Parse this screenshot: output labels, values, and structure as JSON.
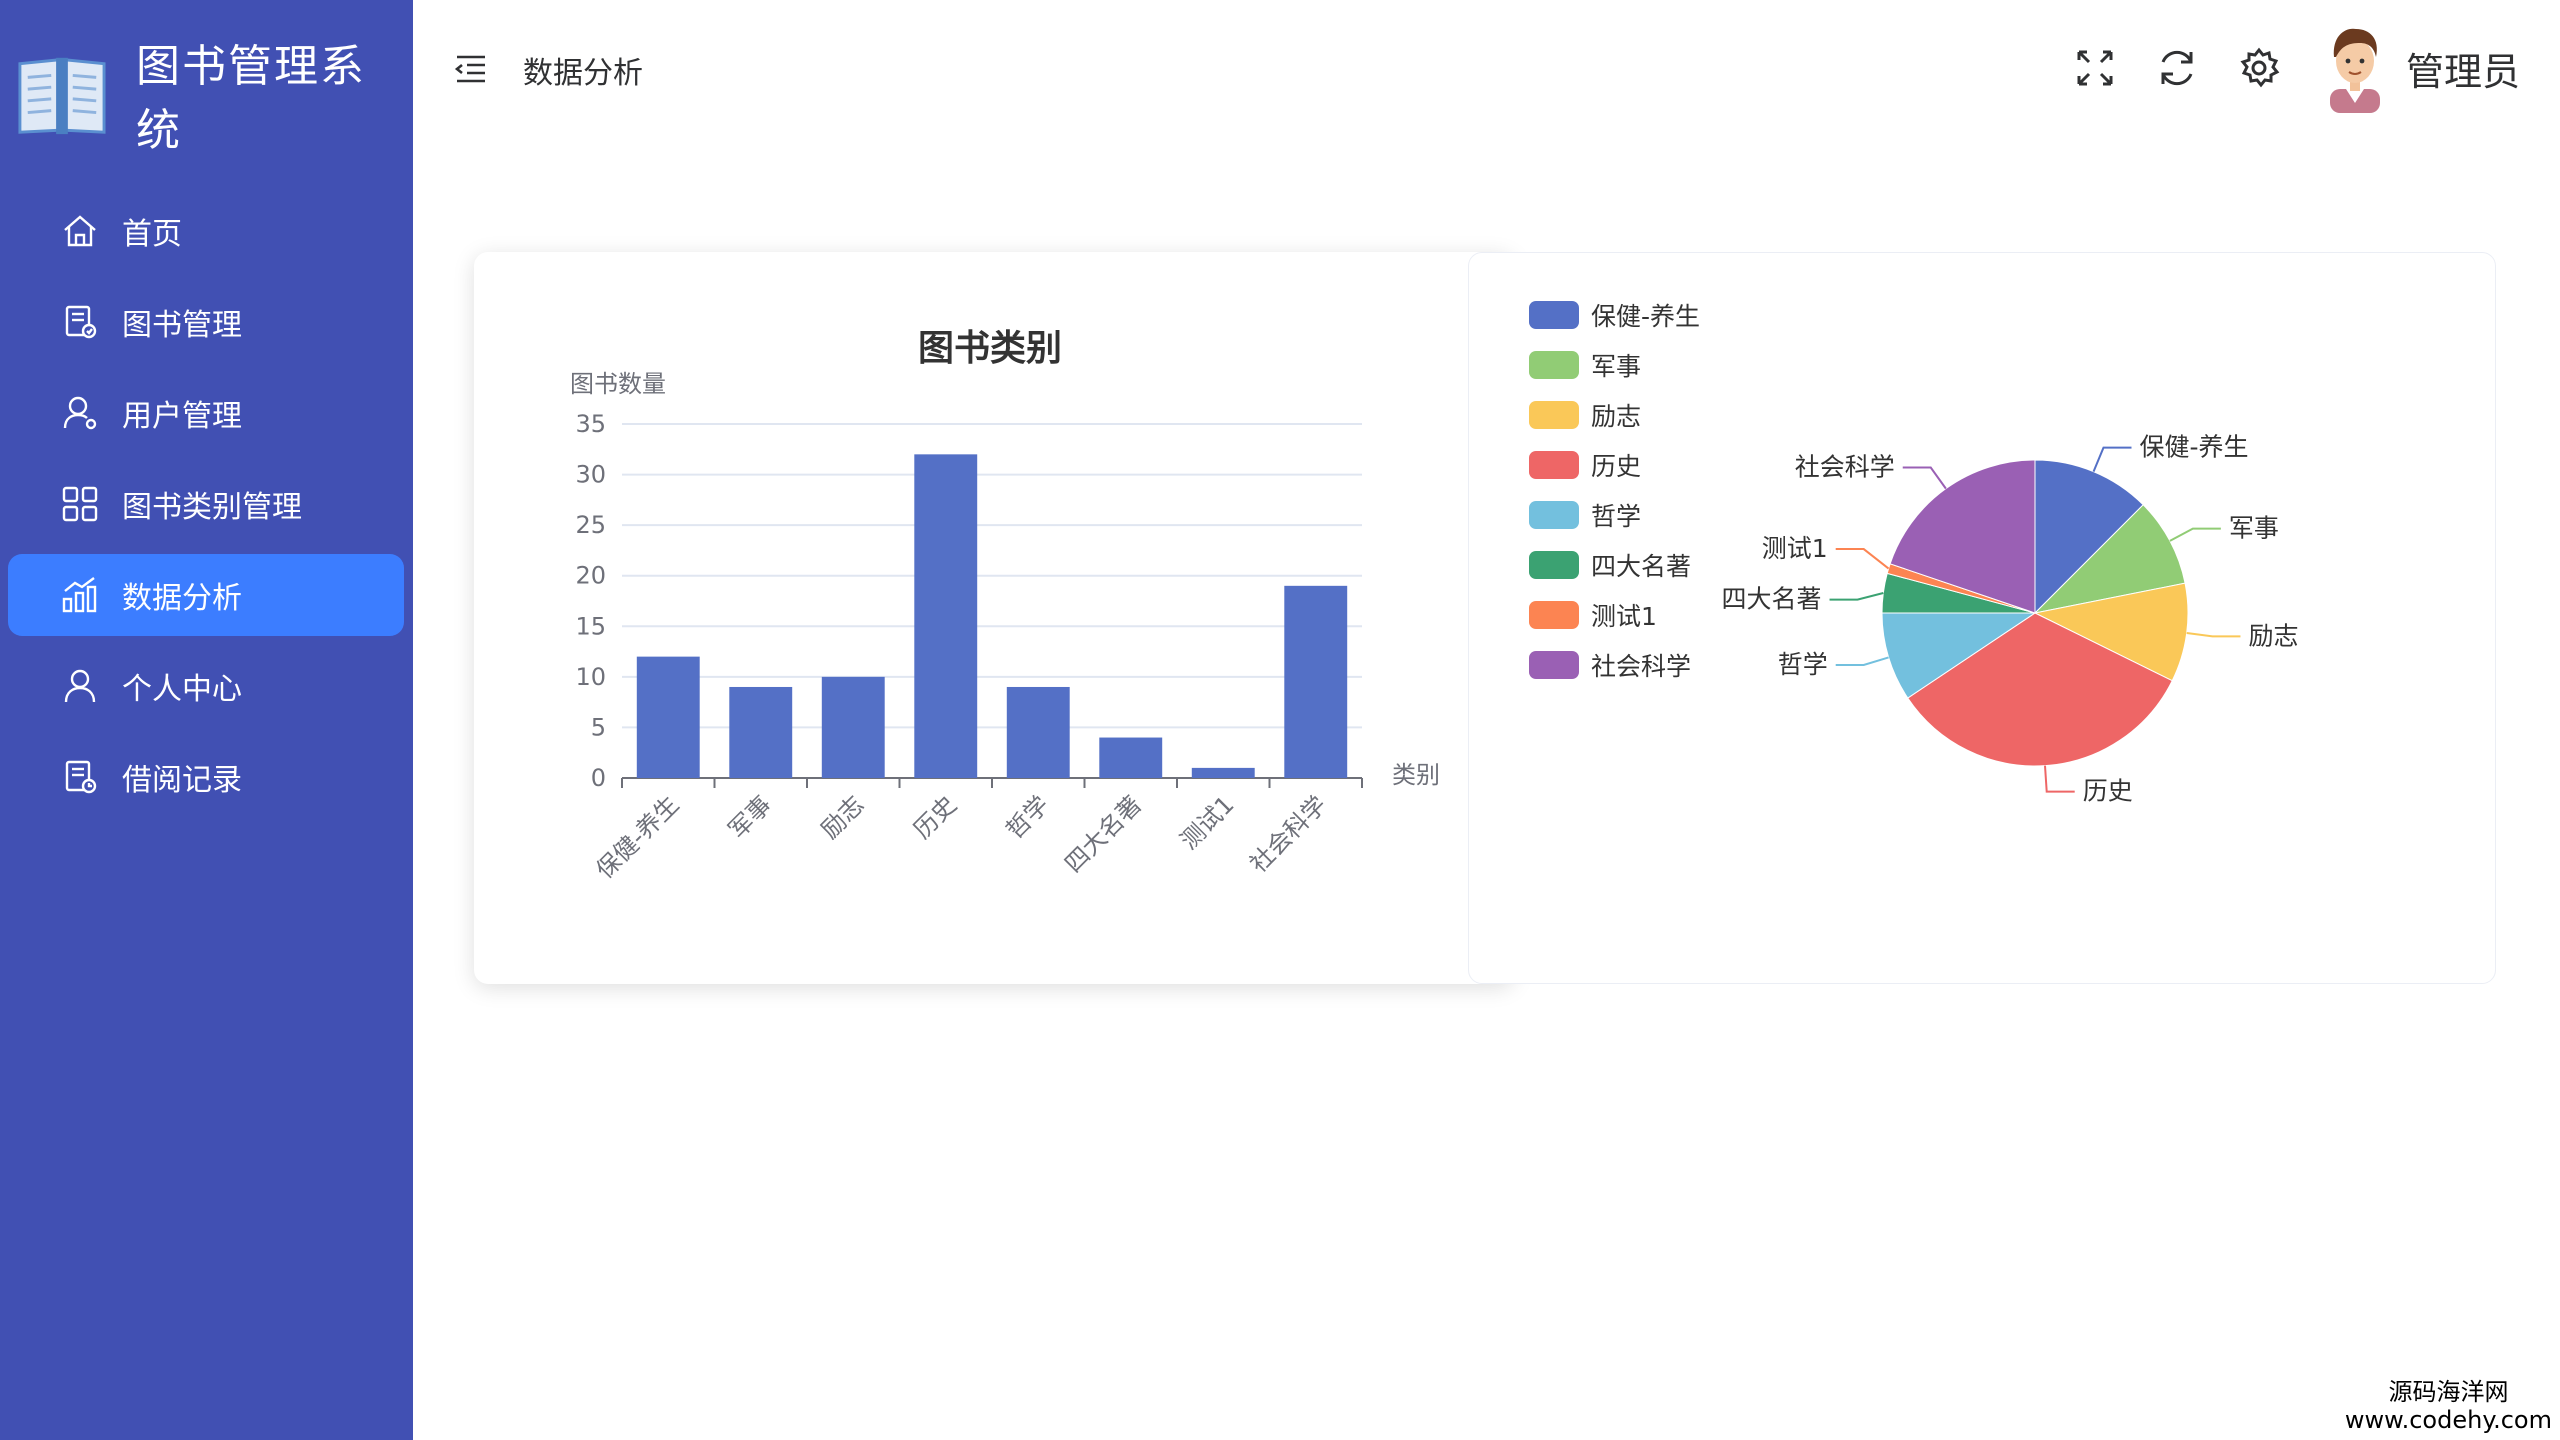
{
  "app": {
    "title": "图书管理系统"
  },
  "sidebar": {
    "items": [
      {
        "label": "首页",
        "icon": "home-icon",
        "active": false
      },
      {
        "label": "图书管理",
        "icon": "book-manage-icon",
        "active": false
      },
      {
        "label": "用户管理",
        "icon": "user-manage-icon",
        "active": false
      },
      {
        "label": "图书类别管理",
        "icon": "category-grid-icon",
        "active": false
      },
      {
        "label": "数据分析",
        "icon": "chart-icon",
        "active": true
      },
      {
        "label": "个人中心",
        "icon": "person-icon",
        "active": false
      },
      {
        "label": "借阅记录",
        "icon": "record-icon",
        "active": false
      }
    ]
  },
  "header": {
    "breadcrumb": "数据分析",
    "username": "管理员"
  },
  "colors": {
    "sidebar_bg": "#4150b3",
    "active_bg": "#3c7dff"
  },
  "chart_data": [
    {
      "type": "bar",
      "title": "图书类别",
      "ylabel": "图书数量",
      "xlabel": "类别",
      "categories": [
        "保健-养生",
        "军事",
        "励志",
        "历史",
        "哲学",
        "四大名著",
        "测试1",
        "社会科学"
      ],
      "values": [
        12,
        9,
        10,
        32,
        9,
        4,
        1,
        19
      ],
      "ylim": [
        0,
        35
      ],
      "yticks": [
        0,
        5,
        10,
        15,
        20,
        25,
        30,
        35
      ],
      "color": "#5470c6",
      "grid": true
    },
    {
      "type": "pie",
      "categories": [
        "保健-养生",
        "军事",
        "励志",
        "历史",
        "哲学",
        "四大名著",
        "测试1",
        "社会科学"
      ],
      "values": [
        12,
        9,
        10,
        32,
        9,
        4,
        1,
        19
      ],
      "colors": [
        "#5470c6",
        "#91cc75",
        "#fac858",
        "#ee6666",
        "#73c0de",
        "#3ba272",
        "#fc8452",
        "#9a60b4"
      ],
      "legend": "top-left"
    }
  ],
  "watermark": {
    "line1": "源码海洋网",
    "line2": "www.codehy.com"
  }
}
